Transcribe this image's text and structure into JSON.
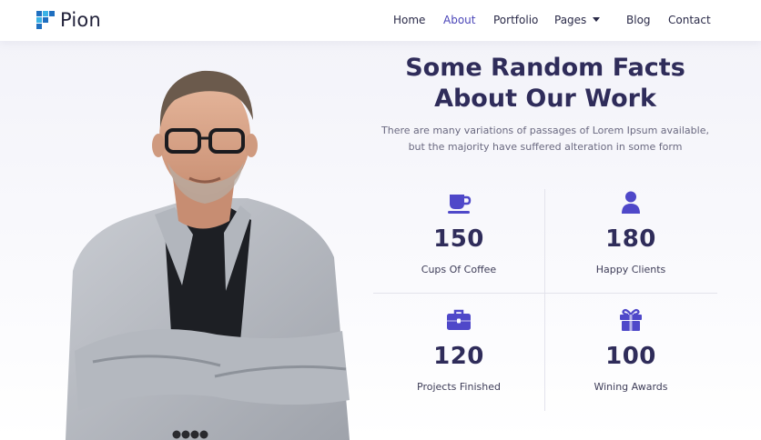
{
  "brand": {
    "name": "Pion"
  },
  "nav": {
    "items": [
      {
        "label": "Home",
        "active": false
      },
      {
        "label": "About",
        "active": true
      },
      {
        "label": "Portfolio",
        "active": false
      },
      {
        "label": "Pages",
        "active": false,
        "has_dropdown": true
      },
      {
        "label": "Blog",
        "active": false
      },
      {
        "label": "Contact",
        "active": false
      }
    ]
  },
  "section": {
    "title_line1": "Some Random Facts",
    "title_line2": "About Our Work",
    "description_line1": "There are many variations of passages of Lorem Ipsum available,",
    "description_line2": "but the majority have suffered alteration in some form"
  },
  "stats": [
    {
      "icon": "coffee-cup-icon",
      "value": "150",
      "label": "Cups Of Coffee"
    },
    {
      "icon": "user-icon",
      "value": "180",
      "label": "Happy Clients"
    },
    {
      "icon": "briefcase-icon",
      "value": "120",
      "label": "Projects Finished"
    },
    {
      "icon": "gift-icon",
      "value": "100",
      "label": "Wining Awards"
    }
  ],
  "colors": {
    "accent": "#4b46b8",
    "heading": "#2f2c5a",
    "icon": "#4f48c9",
    "logo_light": "#3bb3e6",
    "logo_dark": "#1f6fc0"
  }
}
